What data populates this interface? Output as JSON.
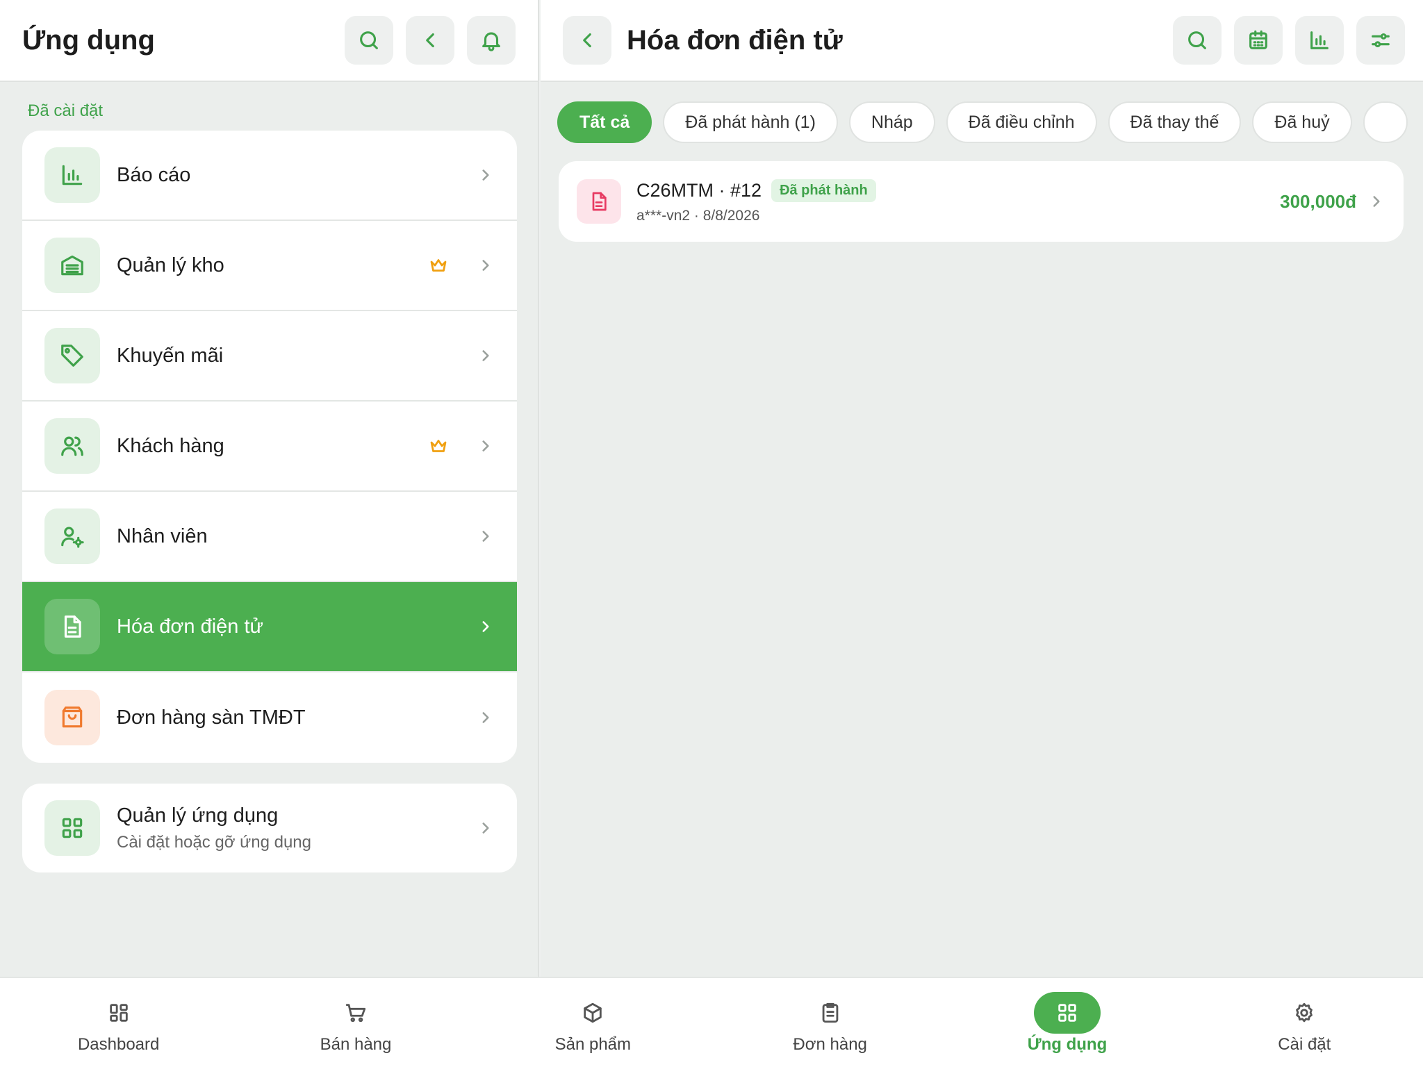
{
  "left": {
    "title": "Ứng dụng",
    "section_label": "Đã cài đặt",
    "items": [
      {
        "label": "Báo cáo",
        "icon": "bar-chart-icon",
        "premium": false,
        "active": false
      },
      {
        "label": "Quản lý kho",
        "icon": "warehouse-icon",
        "premium": true,
        "active": false
      },
      {
        "label": "Khuyến mãi",
        "icon": "tag-icon",
        "premium": false,
        "active": false
      },
      {
        "label": "Khách hàng",
        "icon": "users-icon",
        "premium": true,
        "active": false
      },
      {
        "label": "Nhân viên",
        "icon": "user-gear-icon",
        "premium": false,
        "active": false
      },
      {
        "label": "Hóa đơn điện tử",
        "icon": "document-icon",
        "premium": false,
        "active": true
      },
      {
        "label": "Đơn hàng sàn TMĐT",
        "icon": "shopping-bag-icon",
        "premium": false,
        "active": false
      }
    ],
    "manage": {
      "title": "Quản lý ứng dụng",
      "subtitle": "Cài đặt hoặc gỡ ứng dụng"
    }
  },
  "right": {
    "title": "Hóa đơn điện tử",
    "tabs": [
      {
        "label": "Tất cả",
        "active": true
      },
      {
        "label": "Đã phát hành (1)",
        "active": false
      },
      {
        "label": "Nháp",
        "active": false
      },
      {
        "label": "Đã điều chỉnh",
        "active": false
      },
      {
        "label": "Đã thay thế",
        "active": false
      },
      {
        "label": "Đã huỷ",
        "active": false
      }
    ],
    "invoice": {
      "code": "C26MTM · #12",
      "status": "Đã phát hành",
      "meta": "a***-vn2 · 8/8/2026",
      "amount": "300,000đ"
    }
  },
  "bottom_nav": [
    {
      "label": "Dashboard",
      "icon": "dashboard-icon",
      "active": false
    },
    {
      "label": "Bán hàng",
      "icon": "cart-icon",
      "active": false
    },
    {
      "label": "Sản phẩm",
      "icon": "box-icon",
      "active": false
    },
    {
      "label": "Đơn hàng",
      "icon": "clipboard-icon",
      "active": false
    },
    {
      "label": "Ứng dụng",
      "icon": "apps-icon",
      "active": true
    },
    {
      "label": "Cài đặt",
      "icon": "settings-icon",
      "active": false
    }
  ],
  "colors": {
    "accent": "#4caf50",
    "accent_text": "#3fa24a",
    "premium": "#f0a010",
    "invoice_icon": "#e73a62"
  }
}
